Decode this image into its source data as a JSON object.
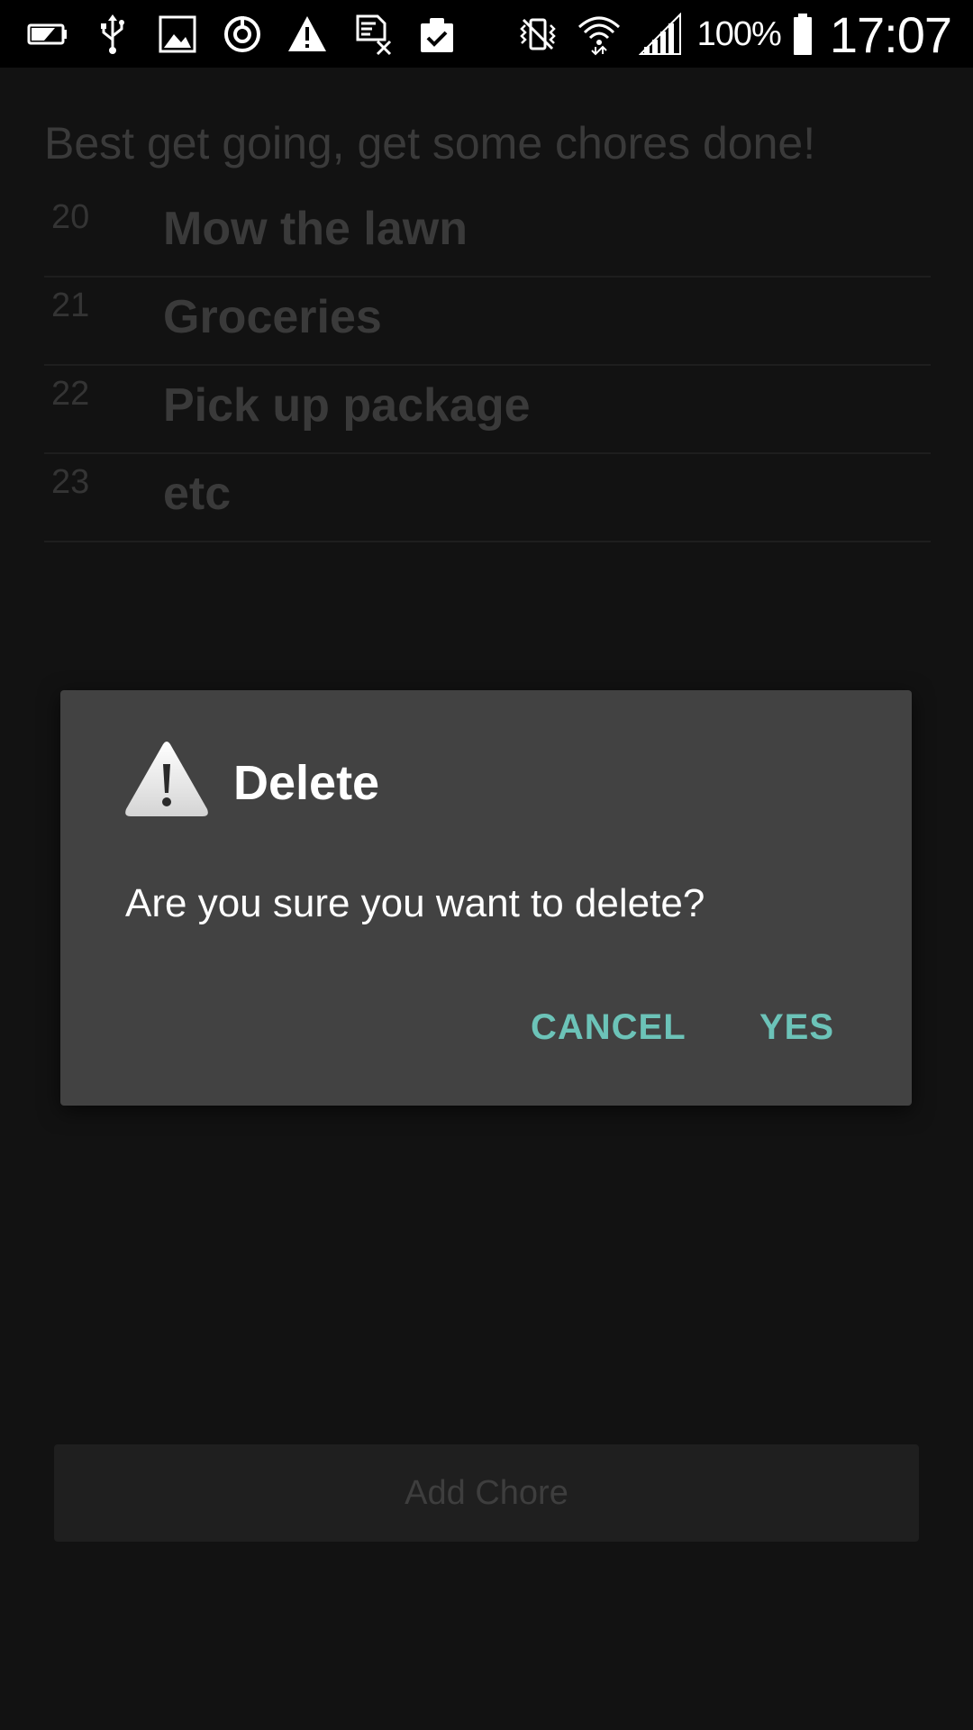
{
  "status_bar": {
    "left_icons": [
      "battery-saver-icon",
      "usb-icon",
      "image-icon",
      "sync-icon",
      "warning-icon",
      "sim-off-icon",
      "clipboard-check-icon"
    ],
    "right_icons": [
      "vibrate-mute-icon",
      "wifi-icon",
      "signal-icon"
    ],
    "battery_percent": "100%",
    "time": "17:07"
  },
  "app": {
    "motto": "Best get going, get some chores done!",
    "chores": [
      {
        "id": "20",
        "name": "Mow the lawn"
      },
      {
        "id": "21",
        "name": "Groceries"
      },
      {
        "id": "22",
        "name": "Pick up package"
      },
      {
        "id": "23",
        "name": "etc"
      }
    ],
    "add_button_label": "Add Chore"
  },
  "dialog": {
    "icon": "warning-icon",
    "title": "Delete",
    "message": "Are you sure you want to delete?",
    "cancel_label": "CANCEL",
    "confirm_label": "YES",
    "accent_color": "#6cc3b8"
  }
}
